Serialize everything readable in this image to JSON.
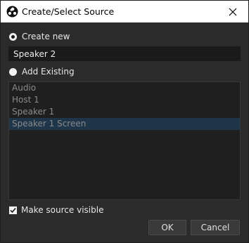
{
  "window": {
    "title": "Create/Select Source",
    "icon": "obs-logo-icon",
    "close_icon": "close-icon"
  },
  "options": {
    "create_new_label": "Create new",
    "create_new_selected": true,
    "name_value": "Speaker 2",
    "add_existing_label": "Add Existing",
    "add_existing_selected": false
  },
  "existing_sources": [
    "Audio",
    "Host 1",
    "Speaker 1",
    "Speaker 1 Screen"
  ],
  "selected_source": "Speaker 1 Screen",
  "make_visible": {
    "label": "Make source visible",
    "checked": true
  },
  "buttons": {
    "ok": "OK",
    "cancel": "Cancel"
  },
  "colors": {
    "background": "#2b2b2b",
    "list_background": "#1f1f1f",
    "selection": "#1f3549"
  }
}
